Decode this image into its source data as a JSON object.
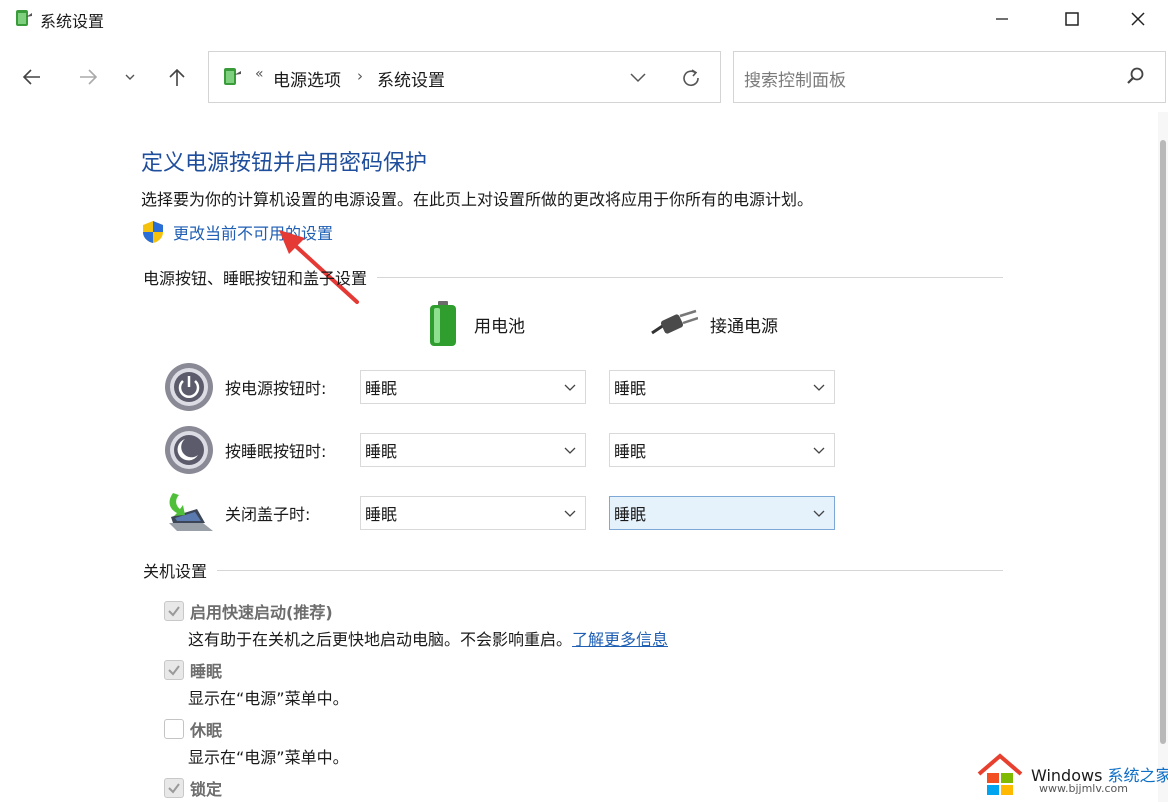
{
  "window": {
    "title": "系统设置",
    "app_icon": "power-options-icon"
  },
  "nav": {
    "back_icon": "arrow-left-icon",
    "forward_icon": "arrow-right-icon",
    "recent_icon": "chevron-down-icon",
    "up_icon": "arrow-up-icon"
  },
  "address": {
    "overflow": "«",
    "crumbs": [
      "电源选项",
      "系统设置"
    ],
    "separator": "›"
  },
  "search": {
    "placeholder": "搜索控制面板"
  },
  "main": {
    "heading": "定义电源按钮并启用密码保护",
    "description": "选择要为你的计算机设置的电源设置。在此页上对设置所做的更改将应用于你所有的电源计划。",
    "change_link": "更改当前不可用的设置"
  },
  "buttons_section": {
    "title": "电源按钮、睡眠按钮和盖子设置",
    "col_battery": "用电池",
    "col_plugged": "接通电源",
    "rows": [
      {
        "label": "按电源按钮时:",
        "battery": "睡眠",
        "plugged": "睡眠",
        "icon": "power-button-icon"
      },
      {
        "label": "按睡眠按钮时:",
        "battery": "睡眠",
        "plugged": "睡眠",
        "icon": "sleep-button-icon"
      },
      {
        "label": "关闭盖子时:",
        "battery": "睡眠",
        "plugged": "睡眠",
        "icon": "laptop-lid-icon"
      }
    ]
  },
  "shutdown_section": {
    "title": "关机设置",
    "options": [
      {
        "title": "启用快速启动(推荐)",
        "checked": true,
        "desc": "这有助于在关机之后更快地启动电脑。不会影响重启。",
        "link": "了解更多信息"
      },
      {
        "title": "睡眠",
        "checked": true,
        "desc": "显示在“电源”菜单中。"
      },
      {
        "title": "休眠",
        "checked": false,
        "desc": "显示在“电源”菜单中。"
      },
      {
        "title": "锁定",
        "checked": true
      }
    ]
  },
  "watermark": {
    "brand_en": "Windows",
    "brand_cn": "系统之家",
    "url": "www.bjjmlv.com"
  },
  "colors": {
    "heading": "#1f4e9c",
    "link": "#1f5fb4",
    "focus_select": "#e5f1fb",
    "annotation_arrow": "#e53935"
  }
}
